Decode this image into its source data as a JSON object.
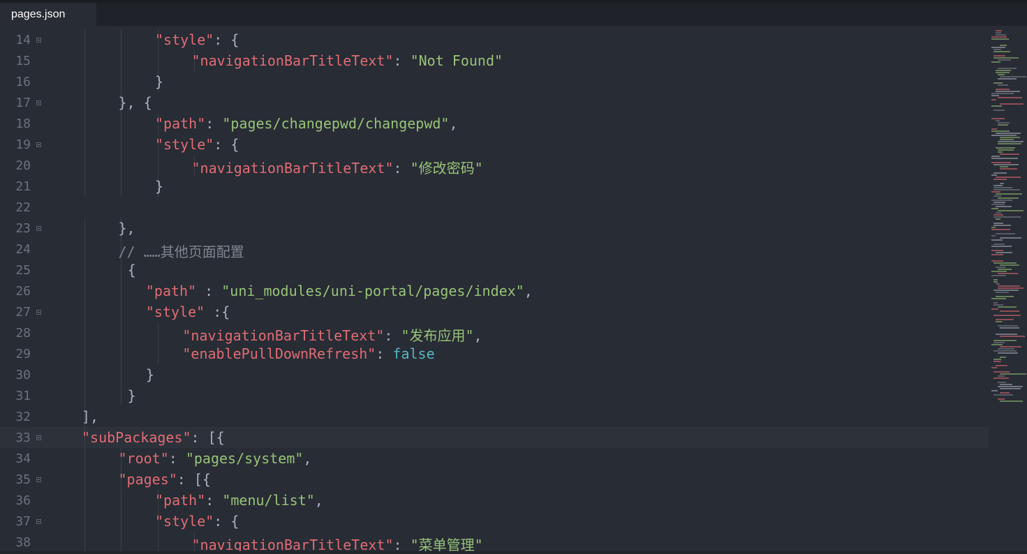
{
  "tab": {
    "title": "pages.json",
    "close_glyph": "×"
  },
  "lines": [
    {
      "num": "14",
      "fold": true,
      "indent": 4,
      "tokens": [
        [
          "k",
          "\"style\""
        ],
        [
          "p",
          ": {"
        ]
      ]
    },
    {
      "num": "15",
      "fold": false,
      "indent": 5,
      "tokens": [
        [
          "k",
          "\"navigationBarTitleText\""
        ],
        [
          "p",
          ": "
        ],
        [
          "s",
          "\"Not Found\""
        ]
      ]
    },
    {
      "num": "16",
      "fold": false,
      "indent": 4,
      "tokens": [
        [
          "p",
          "}"
        ]
      ]
    },
    {
      "num": "17",
      "fold": true,
      "indent": 3,
      "tokens": [
        [
          "p",
          "}, {"
        ]
      ]
    },
    {
      "num": "18",
      "fold": false,
      "indent": 4,
      "tokens": [
        [
          "k",
          "\"path\""
        ],
        [
          "p",
          ": "
        ],
        [
          "s",
          "\"pages/changepwd/changepwd\""
        ],
        [
          "p",
          ","
        ]
      ]
    },
    {
      "num": "19",
      "fold": true,
      "indent": 4,
      "tokens": [
        [
          "k",
          "\"style\""
        ],
        [
          "p",
          ": {"
        ]
      ]
    },
    {
      "num": "20",
      "fold": false,
      "indent": 5,
      "tokens": [
        [
          "k",
          "\"navigationBarTitleText\""
        ],
        [
          "p",
          ": "
        ],
        [
          "s",
          "\"修改密码\""
        ]
      ]
    },
    {
      "num": "21",
      "fold": false,
      "indent": 4,
      "tokens": [
        [
          "p",
          "}"
        ]
      ]
    },
    {
      "num": "22",
      "fold": false,
      "indent": 0,
      "tokens": []
    },
    {
      "num": "23",
      "fold": true,
      "indent": 3,
      "tokens": [
        [
          "p",
          "},"
        ]
      ]
    },
    {
      "num": "24",
      "fold": false,
      "indent": 3,
      "tokens": [
        [
          "c",
          "// ……其他页面配置"
        ]
      ]
    },
    {
      "num": "25",
      "fold": false,
      "indent": 3.25,
      "tokens": [
        [
          "p",
          "{"
        ]
      ]
    },
    {
      "num": "26",
      "fold": false,
      "indent": 3.75,
      "tokens": [
        [
          "k",
          "\"path\""
        ],
        [
          "p",
          " : "
        ],
        [
          "s",
          "\"uni_modules/uni-portal/pages/index\""
        ],
        [
          "p",
          ","
        ]
      ]
    },
    {
      "num": "27",
      "fold": true,
      "indent": 3.75,
      "tokens": [
        [
          "k",
          "\"style\""
        ],
        [
          "p",
          " :{"
        ]
      ]
    },
    {
      "num": "28",
      "fold": false,
      "indent": 4.75,
      "tokens": [
        [
          "k",
          "\"navigationBarTitleText\""
        ],
        [
          "p",
          ": "
        ],
        [
          "s",
          "\"发布应用\""
        ],
        [
          "p",
          ","
        ]
      ]
    },
    {
      "num": "29",
      "fold": false,
      "indent": 4.75,
      "tokens": [
        [
          "k",
          "\"enablePullDownRefresh\""
        ],
        [
          "p",
          ": "
        ],
        [
          "b",
          "false"
        ]
      ]
    },
    {
      "num": "30",
      "fold": false,
      "indent": 3.75,
      "tokens": [
        [
          "p",
          "}"
        ]
      ]
    },
    {
      "num": "31",
      "fold": false,
      "indent": 3.25,
      "tokens": [
        [
          "p",
          "}"
        ]
      ]
    },
    {
      "num": "32",
      "fold": false,
      "indent": 2,
      "tokens": [
        [
          "p",
          "],"
        ]
      ]
    },
    {
      "num": "33",
      "fold": true,
      "indent": 2,
      "current": true,
      "tokens": [
        [
          "k",
          "\"subPackages\""
        ],
        [
          "p",
          ": [{"
        ]
      ]
    },
    {
      "num": "34",
      "fold": false,
      "indent": 3,
      "tokens": [
        [
          "k",
          "\"root\""
        ],
        [
          "p",
          ": "
        ],
        [
          "s",
          "\"pages/system\""
        ],
        [
          "p",
          ","
        ]
      ]
    },
    {
      "num": "35",
      "fold": true,
      "indent": 3,
      "tokens": [
        [
          "k",
          "\"pages\""
        ],
        [
          "p",
          ": [{"
        ]
      ]
    },
    {
      "num": "36",
      "fold": false,
      "indent": 4,
      "tokens": [
        [
          "k",
          "\"path\""
        ],
        [
          "p",
          ": "
        ],
        [
          "s",
          "\"menu/list\""
        ],
        [
          "p",
          ","
        ]
      ]
    },
    {
      "num": "37",
      "fold": true,
      "indent": 4,
      "tokens": [
        [
          "k",
          "\"style\""
        ],
        [
          "p",
          ": {"
        ]
      ]
    },
    {
      "num": "38",
      "fold": false,
      "indent": 5,
      "tokens": [
        [
          "k",
          "\"navigationBarTitleText\""
        ],
        [
          "p",
          ": "
        ],
        [
          "s",
          "\"菜单管理\""
        ]
      ]
    }
  ],
  "colors": {
    "background": "#282c34",
    "key": "#e06c75",
    "string": "#98c379",
    "boolean": "#56b6c2",
    "comment": "#7f848e",
    "punctuation": "#abb2bf",
    "line_number": "#6b717c"
  }
}
